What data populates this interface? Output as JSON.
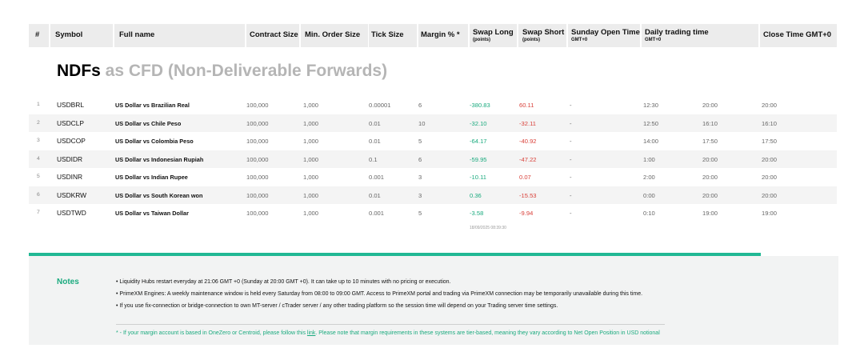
{
  "header": {
    "num": "#",
    "symbol": "Symbol",
    "full_name": "Full name",
    "contract_size": "Contract Size",
    "min_order": "Min. Order Size",
    "tick_size": "Tick Size",
    "margin": "Margin % *",
    "swap_long": "Swap Long",
    "swap_long_sub": "(points)",
    "swap_short": "Swap Short",
    "swap_short_sub": "(points)",
    "sunday_open": "Sunday Open Time",
    "sunday_open_sub": "GMT+0",
    "daily_trading": "Daily trading time",
    "daily_trading_sub": "GMT+0",
    "close_time": "Close Time GMT+0"
  },
  "title": {
    "bold": "NDFs",
    "rest": " as CFD (Non-Deliverable Forwards)"
  },
  "chart_data": {
    "type": "table",
    "columns": [
      "#",
      "Symbol",
      "Full name",
      "Contract Size",
      "Min. Order Size",
      "Tick Size",
      "Margin % *",
      "Swap Long (points)",
      "Swap Short (points)",
      "Sunday Open Time GMT+0",
      "Daily trading time GMT+0 (start)",
      "Daily trading time GMT+0 (end)",
      "Close Time GMT+0"
    ],
    "rows": [
      {
        "n": "1",
        "symbol": "USDBRL",
        "name": "US Dollar vs Brazilian Real",
        "contract": "100,000",
        "min_order": "1,000",
        "tick": "0.00001",
        "margin": "6",
        "swap_long": "-380.83",
        "swap_long_sign": "neg",
        "swap_short": "60.11",
        "swap_short_sign": "neg",
        "sunday": "-",
        "daily_start": "12:30",
        "daily_end": "20:00",
        "close": "20:00"
      },
      {
        "n": "2",
        "symbol": "USDCLP",
        "name": "US Dollar vs Chile Peso",
        "contract": "100,000",
        "min_order": "1,000",
        "tick": "0.01",
        "margin": "10",
        "swap_long": "-32.10",
        "swap_long_sign": "neg",
        "swap_short": "-32.11",
        "swap_short_sign": "neg",
        "sunday": "-",
        "daily_start": "12:50",
        "daily_end": "16:10",
        "close": "16:10"
      },
      {
        "n": "3",
        "symbol": "USDCOP",
        "name": "US Dollar vs Colombia Peso",
        "contract": "100,000",
        "min_order": "1,000",
        "tick": "0.01",
        "margin": "5",
        "swap_long": "-64.17",
        "swap_long_sign": "neg",
        "swap_short": "-40.92",
        "swap_short_sign": "neg",
        "sunday": "-",
        "daily_start": "14:00",
        "daily_end": "17:50",
        "close": "17:50"
      },
      {
        "n": "4",
        "symbol": "USDIDR",
        "name": "US Dollar vs Indonesian Rupiah",
        "contract": "100,000",
        "min_order": "1,000",
        "tick": "0.1",
        "margin": "6",
        "swap_long": "-59.95",
        "swap_long_sign": "neg",
        "swap_short": "-47.22",
        "swap_short_sign": "neg",
        "sunday": "-",
        "daily_start": "1:00",
        "daily_end": "20:00",
        "close": "20:00"
      },
      {
        "n": "5",
        "symbol": "USDINR",
        "name": "US Dollar vs Indian Rupee",
        "contract": "100,000",
        "min_order": "1,000",
        "tick": "0.001",
        "margin": "3",
        "swap_long": "-10.11",
        "swap_long_sign": "neg",
        "swap_short": "0.07",
        "swap_short_sign": "pos",
        "sunday": "-",
        "daily_start": "2:00",
        "daily_end": "20:00",
        "close": "20:00"
      },
      {
        "n": "6",
        "symbol": "USDKRW",
        "name": "US Dollar vs South Korean won",
        "contract": "100,000",
        "min_order": "1,000",
        "tick": "0.01",
        "margin": "3",
        "swap_long": "0.36",
        "swap_long_sign": "pos",
        "swap_short": "-15.53",
        "swap_short_sign": "neg",
        "sunday": "-",
        "daily_start": "0:00",
        "daily_end": "20:00",
        "close": "20:00"
      },
      {
        "n": "7",
        "symbol": "USDTWD",
        "name": "US Dollar vs Taiwan Dollar",
        "contract": "100,000",
        "min_order": "1,000",
        "tick": "0.001",
        "margin": "5",
        "swap_long": "-3.58",
        "swap_long_sign": "neg",
        "swap_short": "-9.94",
        "swap_short_sign": "neg",
        "sunday": "-",
        "daily_start": "0:10",
        "daily_end": "19:00",
        "close": "19:00"
      }
    ]
  },
  "timestamp": "18/09/2025 08:39:30",
  "notes": {
    "title": "Notes",
    "items": [
      "• Liquidity Hubs restart everyday at 21:06 GMT +0 (Sunday at 20:00 GMT +0). It can take up to 10 minutes with no pricing or execution.",
      "• PrimeXM Engines: A weekly maintenance window is held every Saturday from 08:00 to 09:00 GMT. Access to PrimeXM portal and trading via PrimeXM connection may be temporarily unavailable during this time.",
      "• If you use fix-connection or bridge-connection to own MT-server / cTrader server / any other trading platform so the session time will depend on your Trading server time settings."
    ],
    "footnote_pre": "* - If your margin account is based in OneZero or Centroid, please follow this ",
    "footnote_link": "link",
    "footnote_post": ". Please note that margin requirements in these systems are tier-based, meaning they vary according to Net Open Position in USD notional"
  },
  "colors": {
    "positive": "#1aaa7e",
    "negative": "#d9413a",
    "accent": "#21b894",
    "header_bg": "#ececec"
  }
}
